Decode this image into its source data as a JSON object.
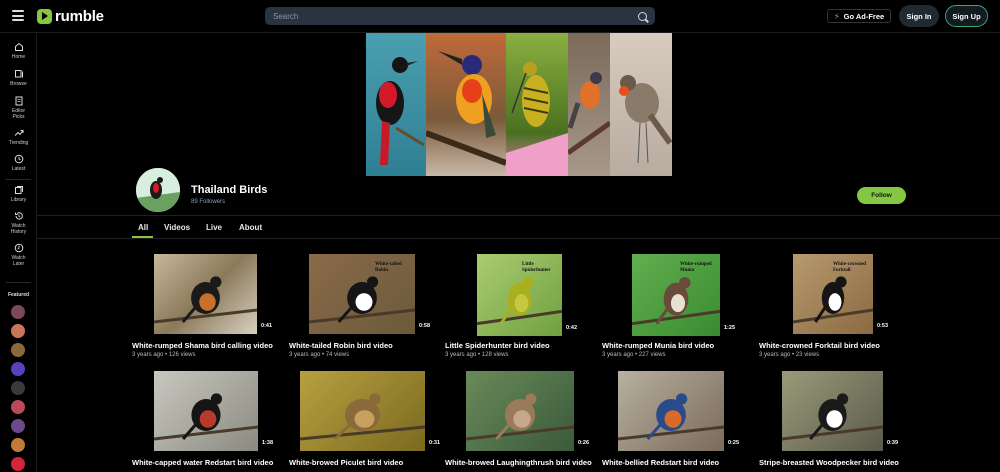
{
  "header": {
    "logo_text": "rumble",
    "search_placeholder": "Search",
    "go_ad_free": "Go Ad-Free",
    "sign_in": "Sign In",
    "sign_up": "Sign Up"
  },
  "sidebar": {
    "items": [
      {
        "label": "Home",
        "icon": "home-icon"
      },
      {
        "label": "Browse",
        "icon": "browse-icon"
      },
      {
        "label": "Editor Picks",
        "icon": "editor-picks-icon"
      },
      {
        "label": "Trending",
        "icon": "trending-icon"
      },
      {
        "label": "Latest",
        "icon": "clock-icon"
      },
      {
        "label": "Library",
        "icon": "library-icon"
      },
      {
        "label": "Watch History",
        "icon": "history-icon"
      },
      {
        "label": "Watch Later",
        "icon": "watch-later-icon"
      }
    ],
    "featured_title": "Featured",
    "featured_colors": [
      "#7a4a5a",
      "#c8755a",
      "#8a6a3a",
      "#5a3fbf",
      "#3a3a3a",
      "#b84a5a",
      "#6a4a8a",
      "#c07a3a",
      "#d4263a"
    ]
  },
  "channel": {
    "name": "Thailand Birds",
    "followers": "89 Followers",
    "follow_label": "Follow"
  },
  "tabs": [
    {
      "label": "All"
    },
    {
      "label": "Videos"
    },
    {
      "label": "Live"
    },
    {
      "label": "About"
    }
  ],
  "videos": [
    {
      "title": "White-rumped Shama bird calling video",
      "meta": "3 years ago • 126 views",
      "duration": "0:41",
      "overlay": ""
    },
    {
      "title": "White-tailed Robin bird video",
      "meta": "3 years ago • 74 views",
      "duration": "0:58",
      "overlay": "White-tailed Robin"
    },
    {
      "title": "Little Spiderhunter bird video",
      "meta": "3 years ago • 128 views",
      "duration": "0:42",
      "overlay": "Little Spiderhunter"
    },
    {
      "title": "White-rumped Munia bird video",
      "meta": "3 years ago • 227 views",
      "duration": "1:25",
      "overlay": "White-rumped Munia"
    },
    {
      "title": "White-crowned Forktail bird video",
      "meta": "3 years ago • 23 views",
      "duration": "0:53",
      "overlay": "White-crowned Forktail"
    },
    {
      "title": "White-capped water Redstart bird video",
      "meta": "",
      "duration": "1:38",
      "overlay": ""
    },
    {
      "title": "White-browed Piculet bird video",
      "meta": "",
      "duration": "0:31",
      "overlay": ""
    },
    {
      "title": "White-browed Laughingthrush bird video",
      "meta": "",
      "duration": "0:26",
      "overlay": ""
    },
    {
      "title": "White-bellied Redstart bird video",
      "meta": "",
      "duration": "0:25",
      "overlay": ""
    },
    {
      "title": "Stripe-breasted Woodpecker bird video",
      "meta": "",
      "duration": "0:39",
      "overlay": ""
    }
  ],
  "colors": {
    "accent": "#85c742",
    "search_bg": "#2a3340",
    "signup_border": "#3aa67a"
  }
}
